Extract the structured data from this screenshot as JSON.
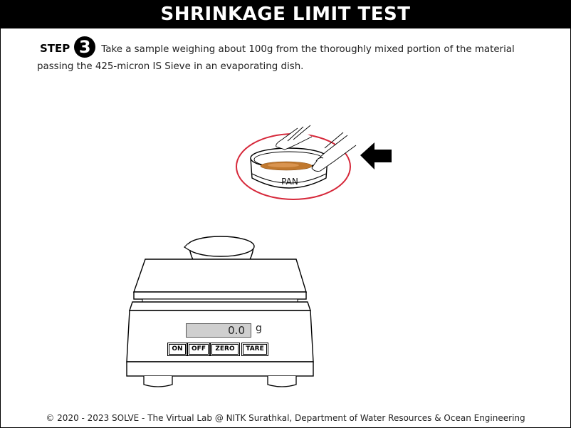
{
  "header": {
    "title": "SHRINKAGE LIMIT TEST"
  },
  "step": {
    "label": "STEP",
    "number": "3",
    "instruction": "Take a sample weighing about 100g from the thoroughly mixed portion of the material passing the 425-micron IS Sieve in an evaporating dish."
  },
  "pan": {
    "label": "PAN"
  },
  "balance": {
    "display_value": "0.0",
    "unit": "g",
    "buttons": {
      "on": "ON",
      "off": "OFF",
      "zero": "ZERO",
      "tare": "TARE"
    }
  },
  "colors": {
    "highlight_ring": "#d6283a",
    "soil": "#c0782e",
    "display_bg": "#cfcfcf"
  },
  "footer": {
    "text": "© 2020 - 2023 SOLVE - The Virtual Lab @ NITK Surathkal, Department of Water Resources & Ocean Engineering"
  }
}
